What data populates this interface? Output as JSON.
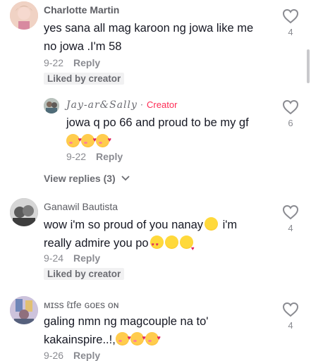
{
  "comments": [
    {
      "name": "Charlotte Martin",
      "text_line1": "yes sana all mag karoon ng jowa like me",
      "text_line2": "no jowa .I'm 58",
      "date": "9-22",
      "reply_label": "Reply",
      "badge": "Liked by creator",
      "likes": "4",
      "avatar_color": "#e8b9a6"
    },
    {
      "name": "Jay-ar&Sally",
      "creator_dot": "·",
      "creator_label": "Creator",
      "text": "jowa q po 66 and proud to be my gf",
      "date": "9-22",
      "reply_label": "Reply",
      "likes": "6",
      "avatar_color": "#9aa6a0"
    },
    {
      "view_replies": "View replies (3)"
    },
    {
      "name": "Ganawil Bautista",
      "text_line1": "wow i'm so proud of you nanay",
      "text_line1b": " i'm",
      "text_line2": "really admire you po",
      "date": "9-24",
      "reply_label": "Reply",
      "badge": "Liked by creator",
      "likes": "4",
      "avatar_color": "#8d8d8d"
    },
    {
      "name": "ᴍɪss ℓɪfe ɢoᴇs oɴ",
      "text_line1": "galing nmn ng magcouple na to'",
      "text_line2": "kakainspire..!,",
      "date": "9-26",
      "reply_label": "Reply",
      "likes": "4",
      "avatar_color": "#b5a8c9"
    }
  ],
  "colors": {
    "accent": "#fe2c55",
    "muted": "#8a8b91",
    "badge_bg": "#f1f1f2"
  },
  "icons": {
    "like": "heart-outline-icon",
    "expand": "chevron-down-icon"
  }
}
